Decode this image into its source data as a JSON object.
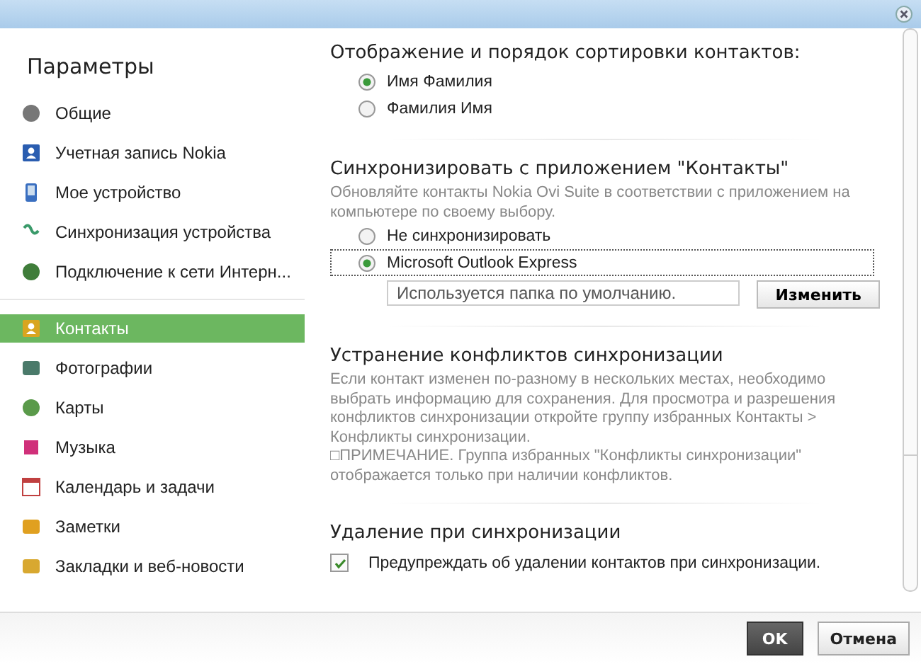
{
  "sidebar": {
    "title": "Параметры",
    "groups": [
      {
        "items": [
          {
            "label": "Общие",
            "selected": false
          },
          {
            "label": "Учетная запись Nokia",
            "selected": false
          },
          {
            "label": "Мое устройство",
            "selected": false
          },
          {
            "label": "Синхронизация устройства",
            "selected": false
          },
          {
            "label": "Подключение к сети Интерн...",
            "selected": false
          }
        ]
      },
      {
        "items": [
          {
            "label": "Контакты",
            "selected": true
          },
          {
            "label": "Фотографии",
            "selected": false
          },
          {
            "label": "Карты",
            "selected": false
          },
          {
            "label": "Музыка",
            "selected": false
          },
          {
            "label": "Календарь и задачи",
            "selected": false
          },
          {
            "label": "Заметки",
            "selected": false
          },
          {
            "label": "Закладки и веб-новости",
            "selected": false
          }
        ]
      }
    ]
  },
  "sections": [
    {
      "kind": "radios",
      "title": "Отображение и порядок сортировки контактов:",
      "options": [
        {
          "label": "Имя Фамилия",
          "selected": true
        },
        {
          "label": "Фамилия Имя",
          "selected": false
        }
      ]
    },
    {
      "kind": "sync",
      "title": "Синхронизировать с приложением \"Контакты\"",
      "description": "Обновляйте контакты Nokia Ovi Suite в соответствии с приложением на компьютере по своему выбору.",
      "options": [
        {
          "label": "Не синхронизировать",
          "selected": false
        },
        {
          "label": "Microsoft Outlook Express",
          "selected": true
        }
      ],
      "folder": {
        "value": "Используется папка по умолчанию.",
        "button": "Изменить"
      }
    },
    {
      "kind": "text",
      "title": "Устранение конфликтов синхронизации",
      "paragraphs": [
        "Если контакт изменен по-разному в нескольких местах, необходимо выбрать информацию для сохранения. Для просмотра и разрешения конфликтов синхронизации откройте группу избранных Контакты > Конфликты синхронизации.",
        "□ПРИМЕЧАНИЕ. Группа избранных \"Конфликты синхронизации\" отображается только при наличии конфликтов."
      ]
    },
    {
      "kind": "checks",
      "title": "Удаление при синхронизации",
      "options": [
        {
          "label": "Предупреждать об удалении контактов при синхронизации.",
          "checked": true
        }
      ]
    }
  ],
  "buttons": [
    {
      "label": "OK",
      "primary": true
    },
    {
      "label": "Отмена",
      "primary": false
    }
  ]
}
